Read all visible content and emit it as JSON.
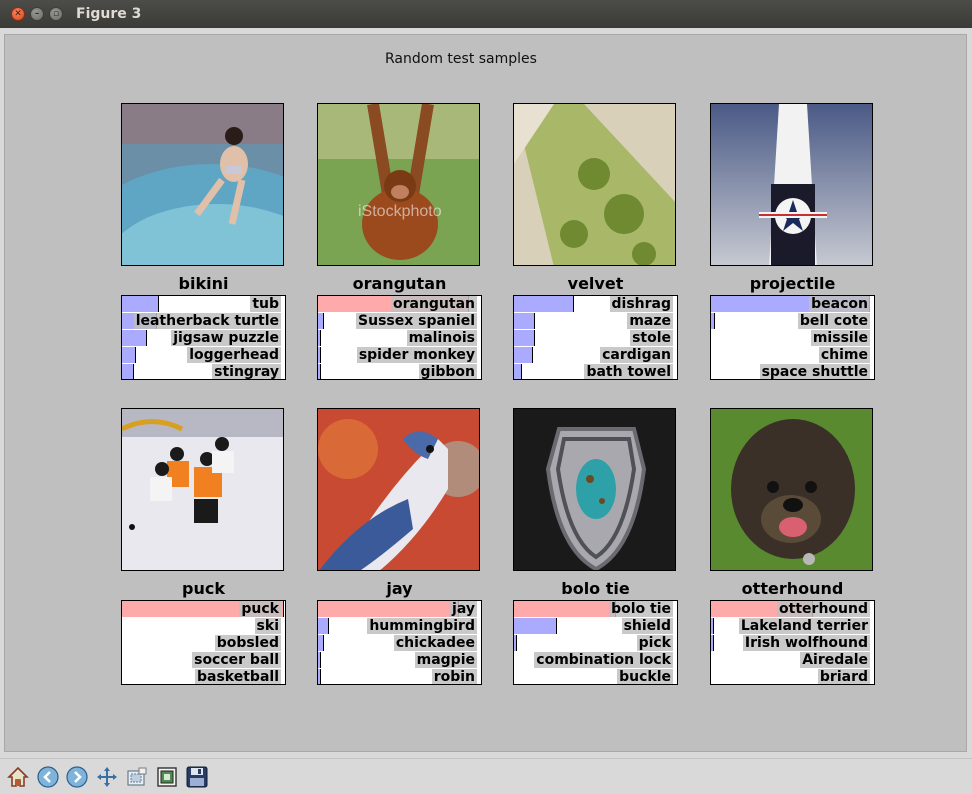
{
  "window": {
    "title": "Figure 3"
  },
  "figure": {
    "suptitle": "Random test samples",
    "colors": {
      "correct": "#ffaaaa",
      "other": "#aaaaff",
      "label_bg": "#bfbfbf"
    },
    "panels": [
      {
        "title": "bikini",
        "image_desc": "woman in swimsuit sitting in a pool",
        "predictions": [
          {
            "label": "tub",
            "p": 0.22,
            "color": "#aaaaff"
          },
          {
            "label": "leatherback turtle",
            "p": 0.21,
            "color": "#aaaaff"
          },
          {
            "label": "jigsaw puzzle",
            "p": 0.15,
            "color": "#aaaaff"
          },
          {
            "label": "loggerhead",
            "p": 0.08,
            "color": "#aaaaff"
          },
          {
            "label": "stingray",
            "p": 0.07,
            "color": "#aaaaff"
          }
        ]
      },
      {
        "title": "orangutan",
        "image_desc": "orangutan hanging from a rope",
        "predictions": [
          {
            "label": "orangutan",
            "p": 0.92,
            "color": "#ffaaaa"
          },
          {
            "label": "Sussex spaniel",
            "p": 0.03,
            "color": "#aaaaff"
          },
          {
            "label": "malinois",
            "p": 0.01,
            "color": "#aaaaff"
          },
          {
            "label": "spider monkey",
            "p": 0.01,
            "color": "#aaaaff"
          },
          {
            "label": "gibbon",
            "p": 0.01,
            "color": "#aaaaff"
          }
        ]
      },
      {
        "title": "velvet",
        "image_desc": "green patterned fabric on a towel",
        "predictions": [
          {
            "label": "dishrag",
            "p": 0.36,
            "color": "#aaaaff"
          },
          {
            "label": "maze",
            "p": 0.12,
            "color": "#aaaaff"
          },
          {
            "label": "stole",
            "p": 0.12,
            "color": "#aaaaff"
          },
          {
            "label": "cardigan",
            "p": 0.11,
            "color": "#aaaaff"
          },
          {
            "label": "bath towel",
            "p": 0.04,
            "color": "#aaaaff"
          }
        ]
      },
      {
        "title": "projectile",
        "image_desc": "rocket with star insignia against sky",
        "predictions": [
          {
            "label": "beacon",
            "p": 0.97,
            "color": "#aaaaff"
          },
          {
            "label": "bell cote",
            "p": 0.02,
            "color": "#aaaaff"
          },
          {
            "label": "missile",
            "p": 0.0,
            "color": "#aaaaff"
          },
          {
            "label": "chime",
            "p": 0.0,
            "color": "#aaaaff"
          },
          {
            "label": "space shuttle",
            "p": 0.0,
            "color": "#aaaaff"
          }
        ]
      },
      {
        "title": "puck",
        "image_desc": "ice hockey players on rink",
        "predictions": [
          {
            "label": "puck",
            "p": 0.99,
            "color": "#ffaaaa"
          },
          {
            "label": "ski",
            "p": 0.0,
            "color": "#aaaaff"
          },
          {
            "label": "bobsled",
            "p": 0.0,
            "color": "#aaaaff"
          },
          {
            "label": "soccer ball",
            "p": 0.0,
            "color": "#aaaaff"
          },
          {
            "label": "basketball",
            "p": 0.0,
            "color": "#aaaaff"
          }
        ]
      },
      {
        "title": "jay",
        "image_desc": "blue jay bird on red background",
        "predictions": [
          {
            "label": "jay",
            "p": 0.86,
            "color": "#ffaaaa"
          },
          {
            "label": "hummingbird",
            "p": 0.06,
            "color": "#aaaaff"
          },
          {
            "label": "chickadee",
            "p": 0.03,
            "color": "#aaaaff"
          },
          {
            "label": "magpie",
            "p": 0.01,
            "color": "#aaaaff"
          },
          {
            "label": "robin",
            "p": 0.01,
            "color": "#aaaaff"
          }
        ]
      },
      {
        "title": "bolo tie",
        "image_desc": "silver bolo tie with turquoise stone",
        "predictions": [
          {
            "label": "bolo tie",
            "p": 0.62,
            "color": "#ffaaaa"
          },
          {
            "label": "shield",
            "p": 0.26,
            "color": "#aaaaff"
          },
          {
            "label": "pick",
            "p": 0.01,
            "color": "#aaaaff"
          },
          {
            "label": "combination lock",
            "p": 0.0,
            "color": "#aaaaff"
          },
          {
            "label": "buckle",
            "p": 0.0,
            "color": "#aaaaff"
          }
        ]
      },
      {
        "title": "otterhound",
        "image_desc": "shaggy dog on grass",
        "predictions": [
          {
            "label": "otterhound",
            "p": 0.62,
            "color": "#ffaaaa"
          },
          {
            "label": "Lakeland terrier",
            "p": 0.01,
            "color": "#aaaaff"
          },
          {
            "label": "Irish wolfhound",
            "p": 0.01,
            "color": "#aaaaff"
          },
          {
            "label": "Airedale",
            "p": 0.0,
            "color": "#aaaaff"
          },
          {
            "label": "briard",
            "p": 0.0,
            "color": "#aaaaff"
          }
        ]
      }
    ]
  },
  "toolbar": {
    "buttons": [
      {
        "name": "home-button",
        "icon": "home-icon"
      },
      {
        "name": "back-button",
        "icon": "back-arrow-icon"
      },
      {
        "name": "forward-button",
        "icon": "forward-arrow-icon"
      },
      {
        "name": "pan-button",
        "icon": "pan-move-icon"
      },
      {
        "name": "zoom-button",
        "icon": "zoom-rect-icon"
      },
      {
        "name": "configure-subplots-button",
        "icon": "subplots-icon"
      },
      {
        "name": "save-button",
        "icon": "save-floppy-icon"
      }
    ]
  }
}
